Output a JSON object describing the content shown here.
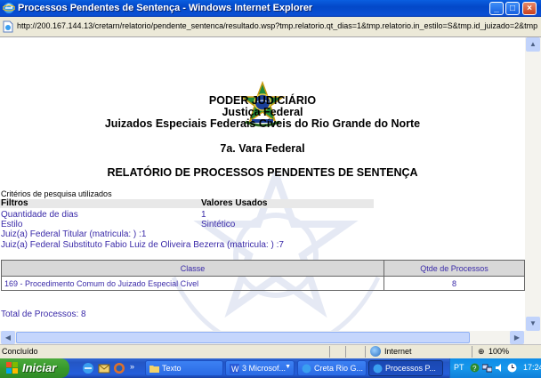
{
  "window": {
    "title": "Processos Pendentes de Sentença - Windows Internet Explorer",
    "url": "http://200.167.144.13/cretarn/relatorio/pendente_sentenca/resultado.wsp?tmp.relatorio.qt_dias=1&tmp.relatorio.in_estilo=S&tmp.id_juizado=2&tmp.id_ju"
  },
  "header": {
    "line1": "PODER JUDICIÁRIO",
    "line2": "Justiça Federal",
    "line3": "Juizados Especiais Federais Cíveis do Rio Grande do Norte",
    "vara": "7a. Vara Federal",
    "report_title": "RELATÓRIO DE PROCESSOS PENDENTES DE SENTENÇA"
  },
  "criteria": {
    "caption": "Critérios de pesquisa utilizados",
    "col_filters": "Filtros",
    "col_values": "Valores Usados",
    "rows": [
      {
        "label": "Quantidade de dias",
        "value": "1"
      },
      {
        "label": "Estilo",
        "value": "Sintético"
      }
    ],
    "judge_titular": "Juiz(a) Federal Titular (matricula: ) :1",
    "judge_substituto": "Juiz(a) Federal Substituto Fabio Luiz de Oliveira Bezerra (matricula: ) :7"
  },
  "results": {
    "col_classe": "Classe",
    "col_qtde": "Qtde de Processos",
    "rows": [
      {
        "classe": "169 - Procedimento Comum do Juizado Especial Cível",
        "qtde": "8"
      }
    ],
    "total": "Total de Processos: 8"
  },
  "statusbar": {
    "status": "Concluído",
    "zone": "Internet",
    "zoom": "100%"
  },
  "taskbar": {
    "start": "Iniciar",
    "buttons": [
      {
        "label": "Texto"
      },
      {
        "label": "3 Microsof..."
      },
      {
        "label": "Creta Rio G..."
      },
      {
        "label": "Processos P..."
      }
    ],
    "lang": "PT",
    "clock": "17:24"
  },
  "colors": {
    "link": "#3a2aa8",
    "titlebar": "#0a4fd4",
    "start": "#379a2c"
  }
}
